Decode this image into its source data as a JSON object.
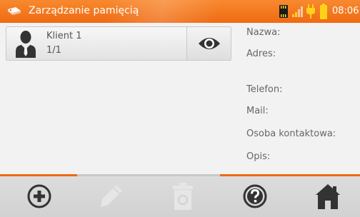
{
  "header": {
    "title": "Zarządzanie pamięcią",
    "app_icon": "meter-probe-icon",
    "status_icons": [
      "sd-card-icon",
      "signal-icon",
      "power-plug-icon",
      "battery-icon"
    ],
    "time": "08:06",
    "accent_color": "#ef6a12"
  },
  "client": {
    "name": "Klient 1",
    "count": "1/1",
    "avatar_icon": "user-avatar-icon",
    "view_icon": "eye-icon"
  },
  "details": {
    "name_label": "Nazwa:",
    "address_label": "Adres:",
    "phone_label": "Telefon:",
    "mail_label": "Mail:",
    "contact_label": "Osoba kontaktowa:",
    "description_label": "Opis:"
  },
  "toolbar": {
    "add_icon": "plus-circle-icon",
    "edit_icon": "pencil-icon",
    "delete_icon": "trash-icon",
    "help_icon": "question-circle-icon",
    "home_icon": "home-icon",
    "disabled": [
      "edit",
      "delete"
    ]
  }
}
